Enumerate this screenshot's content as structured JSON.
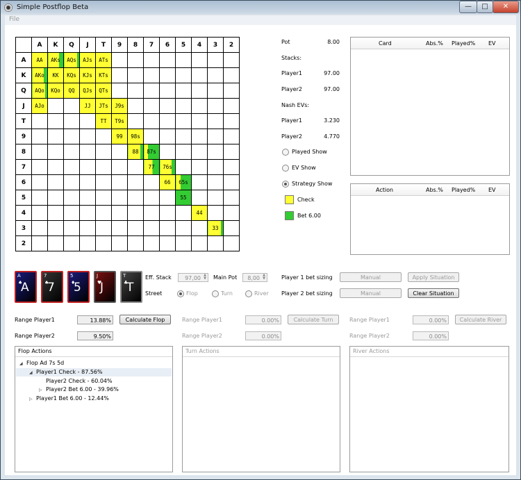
{
  "window": {
    "title": "Simple Postflop Beta",
    "menu": [
      "File"
    ],
    "minimize": "—",
    "maximize": "□",
    "close": "✕"
  },
  "grid": {
    "ranks": [
      "A",
      "K",
      "Q",
      "J",
      "T",
      "9",
      "8",
      "7",
      "6",
      "5",
      "4",
      "3",
      "2"
    ],
    "cells": [
      {
        "r": 0,
        "c": 0,
        "text": "AA",
        "check": 1.0
      },
      {
        "r": 0,
        "c": 1,
        "text": "AKs",
        "check": 0.7
      },
      {
        "r": 0,
        "c": 2,
        "text": "AQs",
        "check": 0.85
      },
      {
        "r": 0,
        "c": 3,
        "text": "AJs",
        "check": 1.0
      },
      {
        "r": 0,
        "c": 4,
        "text": "ATs",
        "check": 1.0
      },
      {
        "r": 1,
        "c": 0,
        "text": "AKo",
        "check": 0.75
      },
      {
        "r": 1,
        "c": 1,
        "text": "KK",
        "check": 1.0
      },
      {
        "r": 1,
        "c": 2,
        "text": "KQs",
        "check": 1.0
      },
      {
        "r": 1,
        "c": 3,
        "text": "KJs",
        "check": 1.0
      },
      {
        "r": 1,
        "c": 4,
        "text": "KTs",
        "check": 1.0
      },
      {
        "r": 2,
        "c": 0,
        "text": "AQo",
        "check": 0.85
      },
      {
        "r": 2,
        "c": 1,
        "text": "KQo",
        "check": 1.0
      },
      {
        "r": 2,
        "c": 2,
        "text": "QQ",
        "check": 1.0
      },
      {
        "r": 2,
        "c": 3,
        "text": "QJs",
        "check": 1.0
      },
      {
        "r": 2,
        "c": 4,
        "text": "QTs",
        "check": 1.0
      },
      {
        "r": 3,
        "c": 0,
        "text": "AJo",
        "check": 1.0
      },
      {
        "r": 3,
        "c": 3,
        "text": "JJ",
        "check": 1.0
      },
      {
        "r": 3,
        "c": 4,
        "text": "JTs",
        "check": 1.0
      },
      {
        "r": 3,
        "c": 5,
        "text": "J9s",
        "check": 1.0
      },
      {
        "r": 4,
        "c": 4,
        "text": "TT",
        "check": 1.0
      },
      {
        "r": 4,
        "c": 5,
        "text": "T9s",
        "check": 1.0
      },
      {
        "r": 5,
        "c": 5,
        "text": "99",
        "check": 1.0
      },
      {
        "r": 5,
        "c": 6,
        "text": "98s",
        "check": 1.0
      },
      {
        "r": 6,
        "c": 6,
        "text": "88",
        "check": 0.8
      },
      {
        "r": 6,
        "c": 7,
        "text": "87s",
        "check": 0.25
      },
      {
        "r": 7,
        "c": 7,
        "text": "77",
        "check": 0.55
      },
      {
        "r": 7,
        "c": 8,
        "text": "76s",
        "check": 0.75
      },
      {
        "r": 8,
        "c": 8,
        "text": "66",
        "check": 1.0
      },
      {
        "r": 8,
        "c": 9,
        "text": "65s",
        "check": 0.3
      },
      {
        "r": 9,
        "c": 9,
        "text": "55",
        "check": 0.0
      },
      {
        "r": 10,
        "c": 10,
        "text": "44",
        "check": 1.0
      },
      {
        "r": 11,
        "c": 11,
        "text": "33",
        "check": 0.85
      }
    ]
  },
  "info": {
    "pot_label": "Pot",
    "pot_value": "8.00",
    "stacks_label": "Stacks:",
    "p1_label": "Player1",
    "p1_stack": "97.00",
    "p2_label": "Player2",
    "p2_stack": "97.00",
    "nash_label": "Nash EVs:",
    "p1_ev_label": "Player1",
    "p1_ev": "3.230",
    "p2_ev_label": "Player2",
    "p2_ev": "4.770"
  },
  "view_modes": {
    "played": "Played Show",
    "ev": "EV Show",
    "strategy": "Strategy Show"
  },
  "legend": {
    "check": "Check",
    "bet": "Bet 6.00",
    "check_color": "#ffff33",
    "bet_color": "#33cc33"
  },
  "card_table": {
    "headers": [
      "Card",
      "Abs.%",
      "Played%",
      "EV"
    ]
  },
  "action_table": {
    "headers": [
      "Action",
      "Abs.%",
      "Played%",
      "EV"
    ]
  },
  "board_cards": [
    {
      "rank": "A",
      "suit": "♠",
      "color": "#1a1a7a",
      "border": "#c02020"
    },
    {
      "rank": "7",
      "suit": "♠",
      "color": "#333333",
      "border": "#c02020"
    },
    {
      "rank": "5",
      "suit": "♦",
      "color": "#1a1a7a",
      "border": "#c02020"
    },
    {
      "rank": "J",
      "suit": "♥",
      "color": "#7a1010",
      "border": "#555555"
    },
    {
      "rank": "T",
      "suit": "♣",
      "color": "#444444",
      "border": "#888888"
    }
  ],
  "situation": {
    "eff_stack_label": "Eff. Stack",
    "eff_stack_value": "97,00",
    "main_pot_label": "Main Pot",
    "main_pot_value": "8,00",
    "street_label": "Street",
    "flop": "Flop",
    "turn": "Turn",
    "river": "River",
    "p1_sizing_label": "Player 1 bet sizing",
    "p2_sizing_label": "Player 2 bet sizing",
    "manual": "Manual",
    "apply": "Apply Situation",
    "clear": "Clear Situation"
  },
  "ranges": {
    "flop": {
      "p1_label": "Range Player1",
      "p1_value": "13.88%",
      "p2_label": "Range Player2",
      "p2_value": "9.50%",
      "button": "Calculate Flop"
    },
    "turn": {
      "p1_label": "Range Player1",
      "p1_value": "0.00%",
      "p2_label": "Range Player2",
      "p2_value": "0.00%",
      "button": "Calculate Turn"
    },
    "river": {
      "p1_label": "Range Player1",
      "p1_value": "0.00%",
      "p2_label": "Range Player2",
      "p2_value": "0.00%",
      "button": "Calculate River"
    }
  },
  "flop_actions": {
    "title": "Flop Actions",
    "root": "Flop Ad 7s 5d",
    "p1_check": "Player1 Check - 87.56%",
    "p2_check": "Player2 Check - 60.04%",
    "p2_bet": "Player2 Bet 6.00 - 39.96%",
    "p1_bet": "Player1 Bet 6.00 - 12.44%"
  },
  "turn_actions": {
    "title": "Turn Actions"
  },
  "river_actions": {
    "title": "River Actions"
  }
}
